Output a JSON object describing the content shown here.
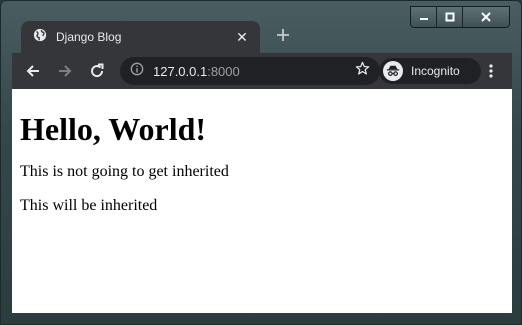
{
  "window": {
    "controls": {
      "minimize_icon": "minimize-icon",
      "maximize_icon": "maximize-icon",
      "close_icon": "close-icon"
    }
  },
  "tab": {
    "title": "Django Blog",
    "favicon": "globe-icon",
    "close_glyph": "✕"
  },
  "toolbar": {
    "url_host": "127.0.0.1",
    "url_port": ":8000",
    "profile_label": "Incognito",
    "icons": [
      "back-icon",
      "forward-icon",
      "reload-icon",
      "info-icon",
      "star-icon",
      "incognito-icon",
      "menu-icon"
    ]
  },
  "page": {
    "heading": "Hello, World!",
    "paragraphs": [
      "This is not going to get inherited",
      "This will be inherited"
    ]
  },
  "colors": {
    "tab_bar": "#35363a",
    "omnibox": "#202124",
    "text_light": "#e8eaed",
    "text_dim": "#9aa0a6"
  }
}
